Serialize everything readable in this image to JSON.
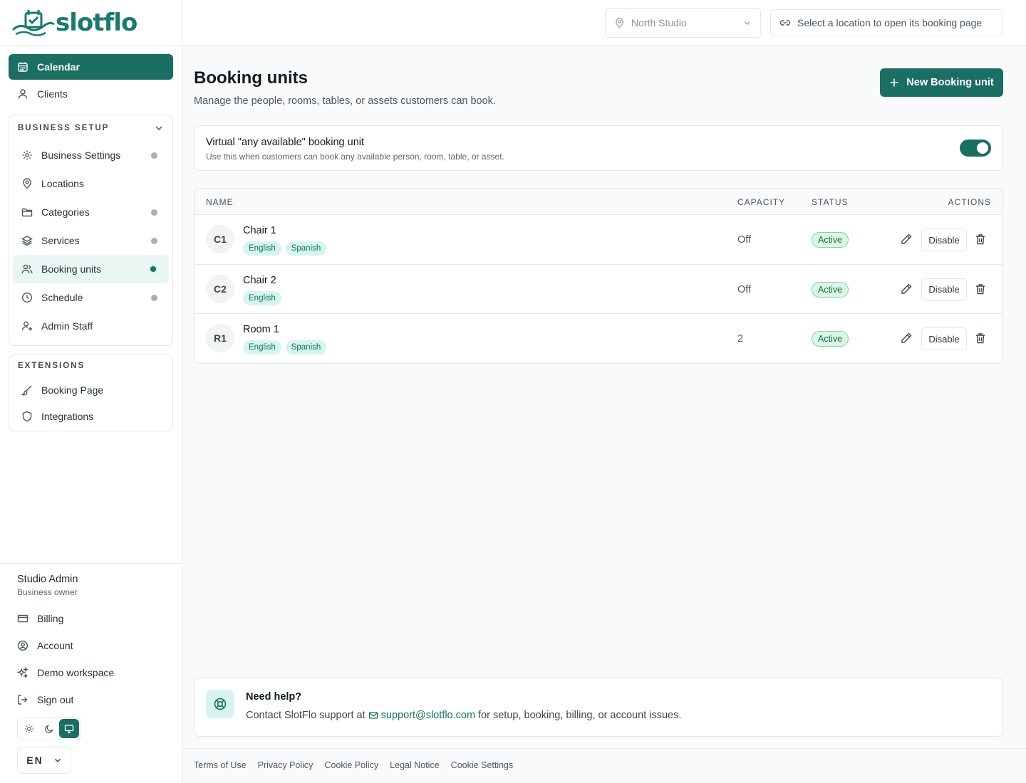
{
  "brand": {
    "name": "slotflo",
    "color": "#1b6e62"
  },
  "nav": {
    "top": [
      {
        "label": "Calendar",
        "icon": "calendar-icon",
        "active": true
      },
      {
        "label": "Clients",
        "icon": "user-icon",
        "active": false
      }
    ],
    "business_setup": {
      "heading": "BUSINESS SETUP",
      "items": [
        {
          "label": "Business Settings",
          "icon": "gear-icon",
          "dot": "gray"
        },
        {
          "label": "Locations",
          "icon": "map-pin-icon",
          "dot": "none"
        },
        {
          "label": "Categories",
          "icon": "folder-icon",
          "dot": "gray"
        },
        {
          "label": "Services",
          "icon": "layers-icon",
          "dot": "gray"
        },
        {
          "label": "Booking units",
          "icon": "users-icon",
          "dot": "green",
          "selected": true
        },
        {
          "label": "Schedule",
          "icon": "clock-icon",
          "dot": "gray"
        },
        {
          "label": "Admin Staff",
          "icon": "user-plus-icon",
          "dot": "none"
        }
      ]
    },
    "extensions": {
      "heading": "EXTENSIONS",
      "items": [
        {
          "label": "Booking Page",
          "icon": "brush-icon"
        },
        {
          "label": "Integrations",
          "icon": "shield-icon"
        }
      ]
    }
  },
  "user": {
    "name": "Studio Admin",
    "role": "Business owner",
    "menu": [
      {
        "label": "Billing",
        "icon": "credit-card-icon"
      },
      {
        "label": "Account",
        "icon": "user-circle-icon"
      },
      {
        "label": "Demo workspace",
        "icon": "sparkles-icon"
      },
      {
        "label": "Sign out",
        "icon": "sign-out-icon"
      }
    ]
  },
  "theme": {
    "options": [
      "light",
      "dark",
      "system"
    ],
    "selected": "system"
  },
  "language": "EN",
  "topbar": {
    "location": "North Studio",
    "open_booking_label": "Select a location to open its booking page"
  },
  "page": {
    "title": "Booking units",
    "subtitle": "Manage the people, rooms, tables, or assets customers can book.",
    "new_button": "New Booking unit"
  },
  "virtual_unit": {
    "title": "Virtual \"any available\" booking unit",
    "description": "Use this when customers can book any available person, room, table, or asset.",
    "enabled": true
  },
  "table": {
    "headers": {
      "name": "NAME",
      "capacity": "CAPACITY",
      "status": "STATUS",
      "actions": "ACTIONS"
    },
    "rows": [
      {
        "initials": "C1",
        "name": "Chair 1",
        "languages": [
          "English",
          "Spanish"
        ],
        "capacity": "Off",
        "status": "Active",
        "action": "Disable"
      },
      {
        "initials": "C2",
        "name": "Chair 2",
        "languages": [
          "English"
        ],
        "capacity": "Off",
        "status": "Active",
        "action": "Disable"
      },
      {
        "initials": "R1",
        "name": "Room 1",
        "languages": [
          "English",
          "Spanish"
        ],
        "capacity": "2",
        "status": "Active",
        "action": "Disable"
      }
    ]
  },
  "help": {
    "title": "Need help?",
    "prefix": "Contact SlotFlo support at",
    "email": "support@slotflo.com",
    "suffix": "for setup, booking, billing, or account issues."
  },
  "footer": {
    "links": [
      "Terms of Use",
      "Privacy Policy",
      "Cookie Policy",
      "Legal Notice",
      "Cookie Settings"
    ]
  }
}
